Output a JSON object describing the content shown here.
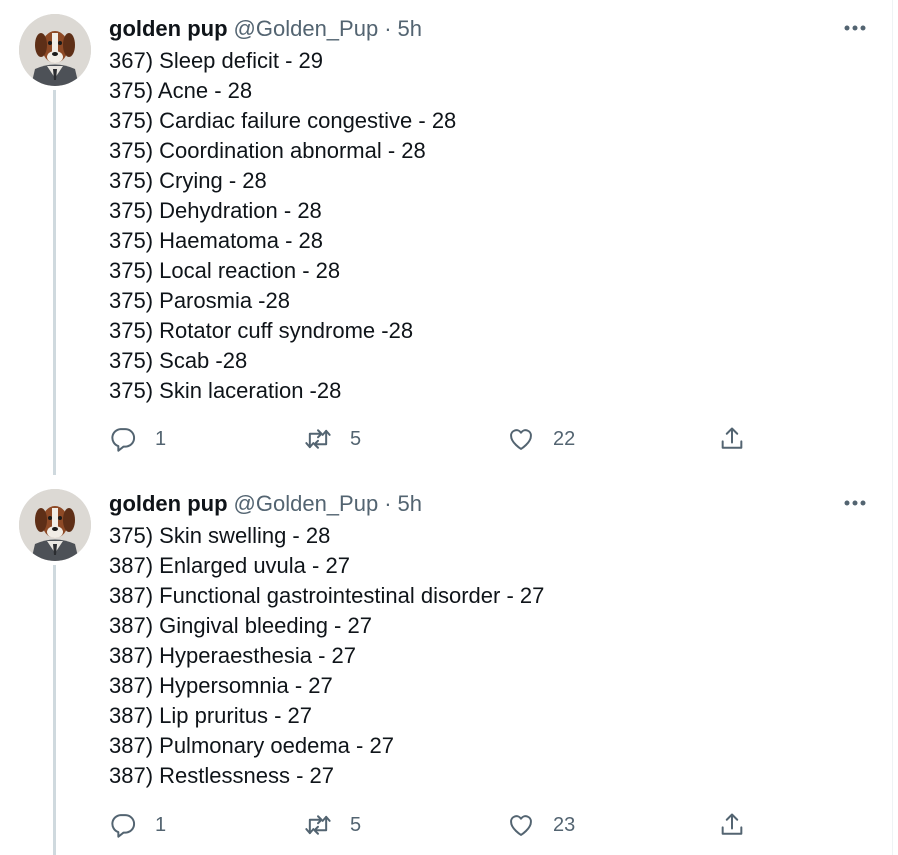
{
  "tweets": [
    {
      "author": {
        "name": "golden pup",
        "handle": "@Golden_Pup",
        "separator": "·",
        "time": "5h"
      },
      "lines": [
        "367) Sleep deficit - 29",
        "375) Acne - 28",
        "375) Cardiac failure congestive - 28",
        "375) Coordination abnormal - 28",
        "375) Crying - 28",
        "375) Dehydration - 28",
        "375) Haematoma - 28",
        "375) Local reaction - 28",
        "375) Parosmia -28",
        "375) Rotator cuff syndrome -28",
        "375) Scab -28",
        "375) Skin laceration -28"
      ],
      "actions": {
        "replies": "1",
        "retweets": "5",
        "likes": "22"
      }
    },
    {
      "author": {
        "name": "golden pup",
        "handle": "@Golden_Pup",
        "separator": "·",
        "time": "5h"
      },
      "lines": [
        "375) Skin swelling - 28",
        "387) Enlarged uvula - 27",
        "387) Functional gastrointestinal disorder - 27",
        "387) Gingival bleeding - 27",
        "387) Hyperaesthesia - 27",
        "387) Hypersomnia - 27",
        "387) Lip pruritus - 27",
        "387) Pulmonary oedema - 27",
        "387) Restlessness - 27"
      ],
      "actions": {
        "replies": "1",
        "retweets": "5",
        "likes": "23"
      }
    }
  ],
  "icons": {
    "avatar": "dog-avatar",
    "more": "more-icon",
    "reply": "reply-icon",
    "retweet": "retweet-icon",
    "like": "like-icon",
    "share": "share-icon"
  },
  "colors": {
    "text": "#0f1419",
    "secondary": "#536471",
    "thread_line": "#cfd9de"
  }
}
